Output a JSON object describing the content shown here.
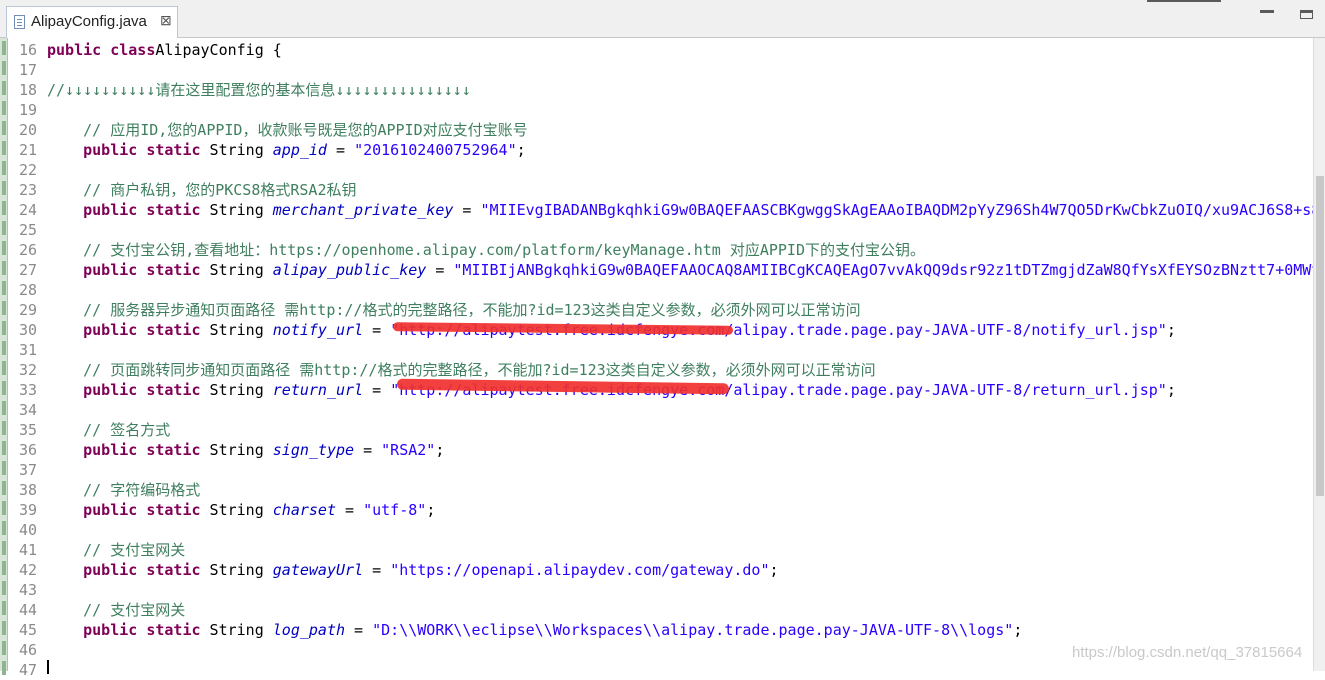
{
  "tab": {
    "filename": "AlipayConfig.java",
    "close_glyph": "⊠"
  },
  "watermark": "https://blog.csdn.net/qq_37815664",
  "lines": [
    {
      "n": "16",
      "segs": [
        [
          "kw",
          "public class"
        ],
        [
          "",
          "AlipayConfig {"
        ]
      ]
    },
    {
      "n": "17",
      "segs": []
    },
    {
      "n": "18",
      "segs": [
        [
          "cmt",
          "//↓↓↓↓↓↓↓↓↓↓请在这里配置您的基本信息↓↓↓↓↓↓↓↓↓↓↓↓↓↓↓"
        ]
      ]
    },
    {
      "n": "19",
      "segs": []
    },
    {
      "n": "20",
      "segs": [
        [
          "cmt",
          "    // 应用ID,您的APPID，收款账号既是您的APPID对应支付宝账号"
        ]
      ]
    },
    {
      "n": "21",
      "segs": [
        [
          "",
          "    "
        ],
        [
          "kw",
          "public static"
        ],
        [
          "",
          " String "
        ],
        [
          "fld",
          "app_id"
        ],
        [
          "",
          " = "
        ],
        [
          "str",
          "\"2016102400752964\""
        ],
        [
          "",
          ";"
        ]
      ]
    },
    {
      "n": "22",
      "segs": []
    },
    {
      "n": "23",
      "segs": [
        [
          "cmt",
          "    // 商户私钥，您的PKCS8格式RSA2私钥"
        ]
      ]
    },
    {
      "n": "24",
      "segs": [
        [
          "",
          "    "
        ],
        [
          "kw",
          "public static"
        ],
        [
          "",
          " String "
        ],
        [
          "fld",
          "merchant_private_key"
        ],
        [
          "",
          " = "
        ],
        [
          "str",
          "\"MIIEvgIBADANBgkqhkiG9w0BAQEFAASCBKgwggSkAgEAAoIBAQDM2pYyZ96Sh4W7QO5DrKwCbkZuOIQ/xu9ACJ6S8+s8"
        ]
      ]
    },
    {
      "n": "25",
      "segs": []
    },
    {
      "n": "26",
      "segs": [
        [
          "cmt",
          "    // 支付宝公钥,查看地址：https://openhome.alipay.com/platform/keyManage.htm 对应APPID下的支付宝公钥。"
        ]
      ]
    },
    {
      "n": "27",
      "segs": [
        [
          "",
          "    "
        ],
        [
          "kw",
          "public static"
        ],
        [
          "",
          " String "
        ],
        [
          "fld",
          "alipay_public_key"
        ],
        [
          "",
          " = "
        ],
        [
          "str",
          "\"MIIBIjANBgkqhkiG9w0BAQEFAAOCAQ8AMIIBCgKCAQEAgO7vvAkQQ9dsr92z1tDTZmgjdZaW8QfYsXfEYSOzBNztt7+0MWt"
        ]
      ]
    },
    {
      "n": "28",
      "segs": []
    },
    {
      "n": "29",
      "segs": [
        [
          "cmt",
          "    // 服务器异步通知页面路径 需http://格式的完整路径，不能加?id=123这类自定义参数，必须外网可以正常访问"
        ]
      ]
    },
    {
      "n": "30",
      "segs": [
        [
          "",
          "    "
        ],
        [
          "kw",
          "public static"
        ],
        [
          "",
          " String "
        ],
        [
          "fld",
          "notify_url"
        ],
        [
          "",
          " = "
        ],
        [
          "str",
          "\"http://alipaytest.free.idcfengye.com/alipay.trade.page.pay-JAVA-UTF-8/notify_url.jsp\""
        ],
        [
          "",
          ";"
        ]
      ]
    },
    {
      "n": "31",
      "segs": []
    },
    {
      "n": "32",
      "segs": [
        [
          "cmt",
          "    // 页面跳转同步通知页面路径 需http://格式的完整路径，不能加?id=123这类自定义参数，必须外网可以正常访问"
        ]
      ]
    },
    {
      "n": "33",
      "segs": [
        [
          "",
          "    "
        ],
        [
          "kw",
          "public static"
        ],
        [
          "",
          " String "
        ],
        [
          "fld",
          "return_url"
        ],
        [
          "",
          " = "
        ],
        [
          "str",
          "\"http://alipaytest.free.idcfengye.com/alipay.trade.page.pay-JAVA-UTF-8/return_url.jsp\""
        ],
        [
          "",
          ";"
        ]
      ]
    },
    {
      "n": "34",
      "segs": []
    },
    {
      "n": "35",
      "segs": [
        [
          "cmt",
          "    // 签名方式"
        ]
      ]
    },
    {
      "n": "36",
      "segs": [
        [
          "",
          "    "
        ],
        [
          "kw",
          "public static"
        ],
        [
          "",
          " String "
        ],
        [
          "fld",
          "sign_type"
        ],
        [
          "",
          " = "
        ],
        [
          "str",
          "\"RSA2\""
        ],
        [
          "",
          ";"
        ]
      ]
    },
    {
      "n": "37",
      "segs": []
    },
    {
      "n": "38",
      "segs": [
        [
          "cmt",
          "    // 字符编码格式"
        ]
      ]
    },
    {
      "n": "39",
      "segs": [
        [
          "",
          "    "
        ],
        [
          "kw",
          "public static"
        ],
        [
          "",
          " String "
        ],
        [
          "fld",
          "charset"
        ],
        [
          "",
          " = "
        ],
        [
          "str",
          "\"utf-8\""
        ],
        [
          "",
          ";"
        ]
      ]
    },
    {
      "n": "40",
      "segs": []
    },
    {
      "n": "41",
      "segs": [
        [
          "cmt",
          "    // 支付宝网关"
        ]
      ]
    },
    {
      "n": "42",
      "segs": [
        [
          "",
          "    "
        ],
        [
          "kw",
          "public static"
        ],
        [
          "",
          " String "
        ],
        [
          "fld",
          "gatewayUrl"
        ],
        [
          "",
          " = "
        ],
        [
          "str",
          "\"https://openapi.alipaydev.com/gateway.do\""
        ],
        [
          "",
          ";"
        ]
      ]
    },
    {
      "n": "43",
      "segs": []
    },
    {
      "n": "44",
      "segs": [
        [
          "cmt",
          "    // 支付宝网关"
        ]
      ]
    },
    {
      "n": "45",
      "segs": [
        [
          "",
          "    "
        ],
        [
          "kw",
          "public static"
        ],
        [
          "",
          " String "
        ],
        [
          "fld",
          "log_path"
        ],
        [
          "",
          " = "
        ],
        [
          "str",
          "\"D:\\\\WORK\\\\eclipse\\\\Workspaces\\\\alipay.trade.page.pay-JAVA-UTF-8\\\\logs\""
        ],
        [
          "",
          ";"
        ]
      ]
    },
    {
      "n": "46",
      "segs": []
    },
    {
      "n": "47",
      "segs": []
    }
  ]
}
